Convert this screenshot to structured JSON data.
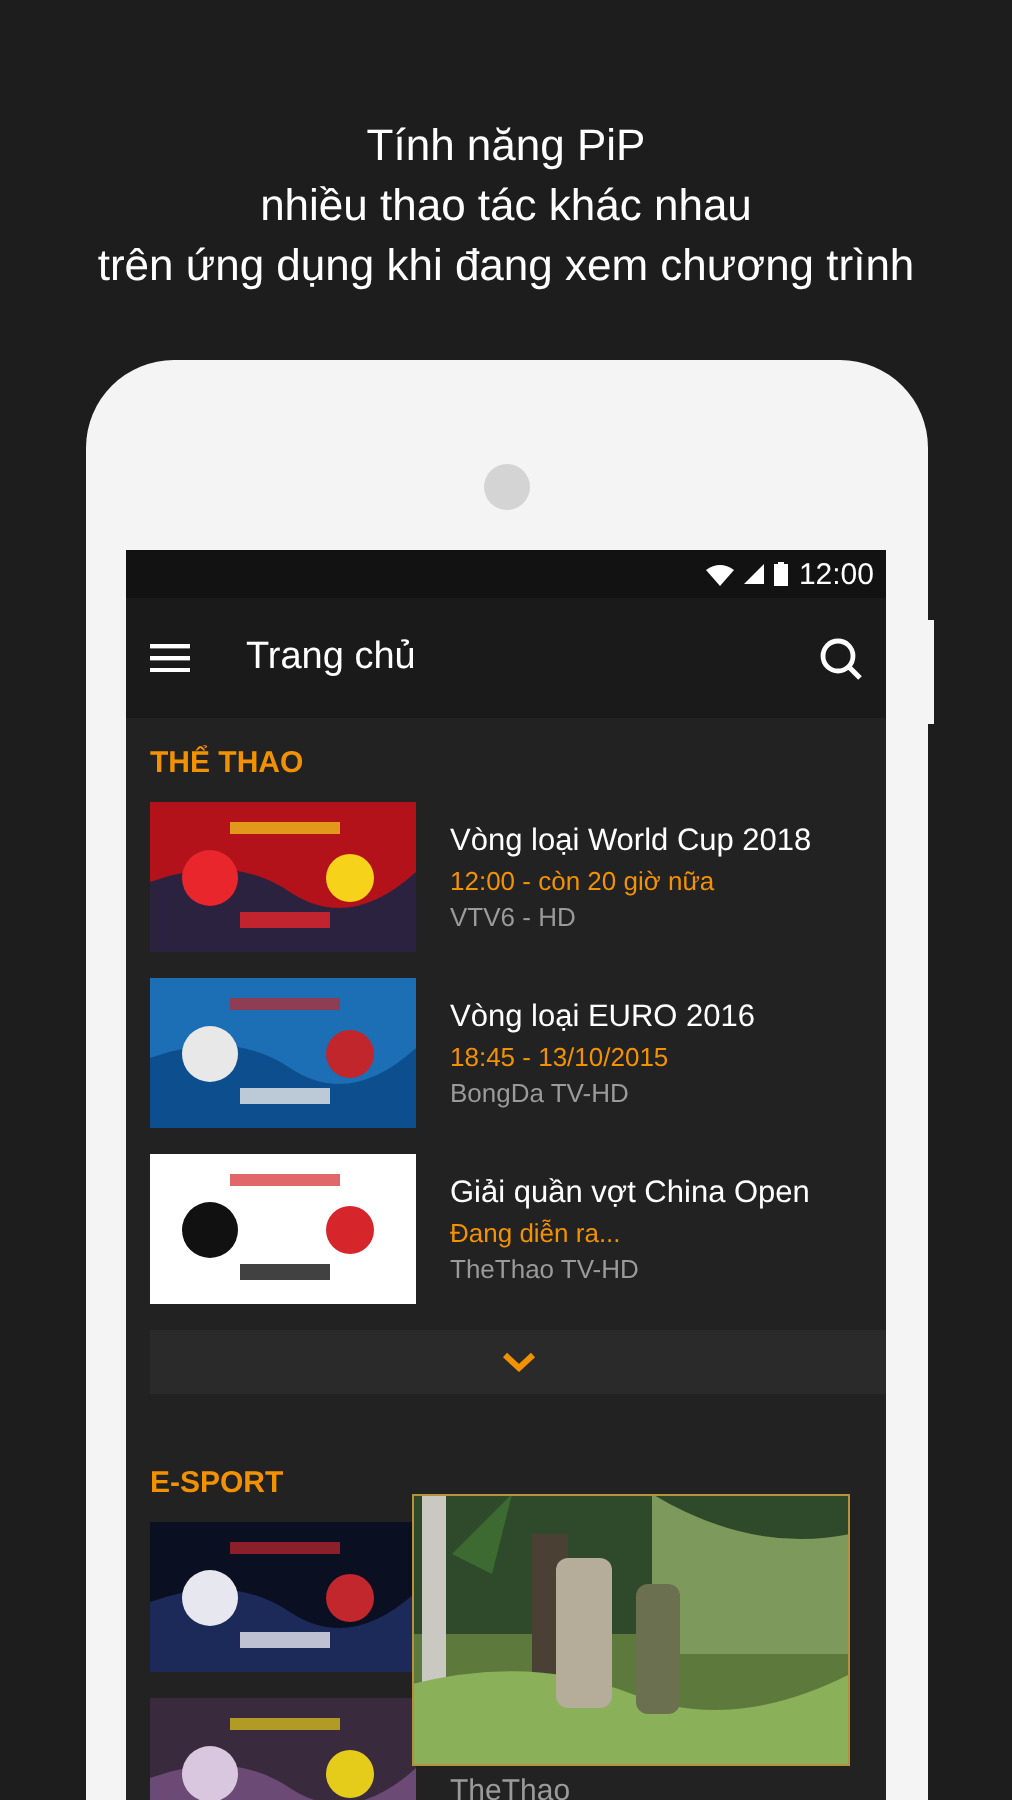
{
  "headline": [
    "Tính năng PiP",
    "nhiều thao tác khác nhau",
    "trên ứng dụng khi đang xem chương trình"
  ],
  "status_bar": {
    "time": "12:00"
  },
  "app_bar": {
    "title": "Trang chủ"
  },
  "sections": [
    {
      "title": "THỂ THAO",
      "more": true,
      "items": [
        {
          "kind": "picture",
          "title": "Vòng loại World Cup 2018",
          "time": "12:00 - còn 20 giờ nữa",
          "channel": "VTV6 - HD"
        },
        {
          "kind": "picture",
          "title": "Vòng loại EURO 2016",
          "time": "18:45 - 13/10/2015",
          "channel": "BongDa TV-HD"
        },
        {
          "kind": "picture",
          "title": "Giải quần vợt China Open",
          "time": "Đang diễn ra...",
          "channel": "TheThao TV-HD"
        }
      ]
    },
    {
      "title": "E-SPORT",
      "items": [
        {
          "kind": "picture"
        },
        {
          "kind": "picture",
          "channel": "TheThao"
        }
      ]
    }
  ],
  "pip": {
    "kind": "picture"
  }
}
